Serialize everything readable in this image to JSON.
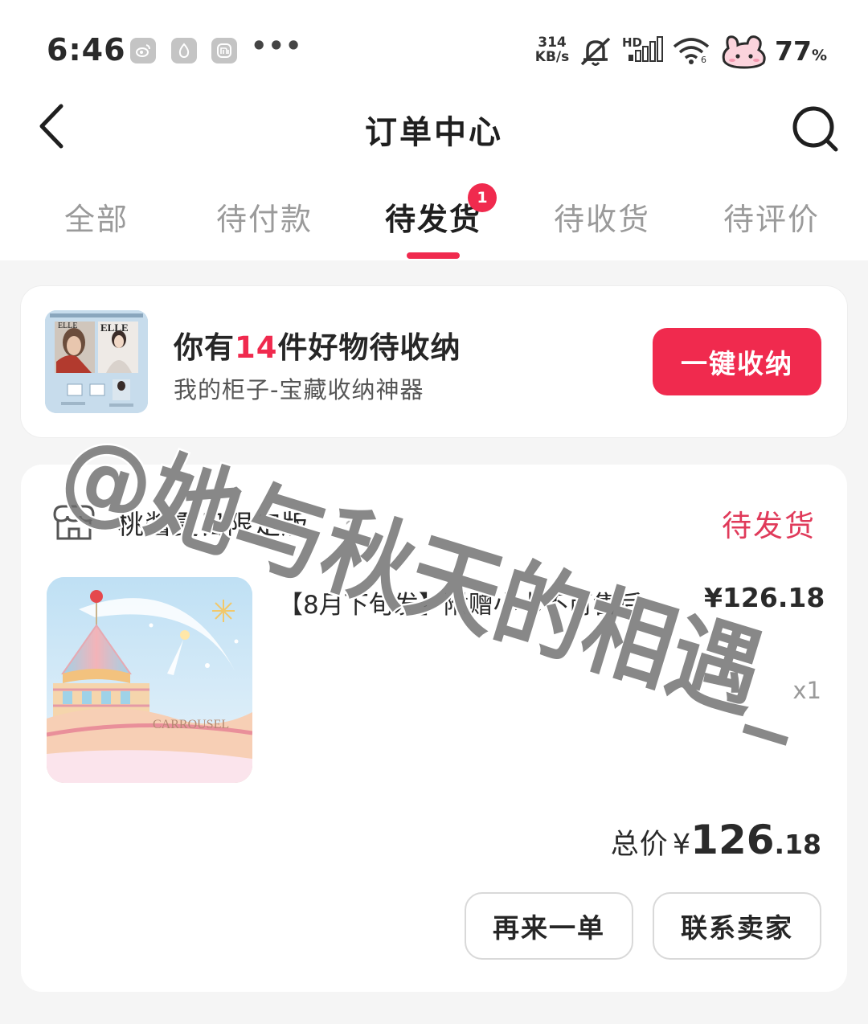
{
  "status_bar": {
    "time": "6:46",
    "net_speed_value": "314",
    "net_speed_unit": "KB/s",
    "hd_label": "HD",
    "wifi_sub": "6",
    "battery_pct": "77",
    "battery_unit": "%",
    "app_icons": [
      "weibo-icon",
      "app-drop-icon",
      "mi-icon"
    ],
    "more": "•••"
  },
  "header": {
    "title": "订单中心"
  },
  "tabs": [
    {
      "label": "全部"
    },
    {
      "label": "待付款"
    },
    {
      "label": "待发货",
      "badge": "1",
      "active": true
    },
    {
      "label": "待收货"
    },
    {
      "label": "待评价"
    }
  ],
  "promo": {
    "title_prefix": "你有",
    "title_count": "14",
    "title_suffix": "件好物待收纳",
    "subtitle": "我的柜子-宝藏收纳神器",
    "button_label": "一键收纳",
    "thumb_text": "ELLE"
  },
  "order": {
    "store_name": "桃酱夏日限定版",
    "store_chevron": "›",
    "status": "待发货",
    "product": {
      "title": "【8月下旬发】附赠小卡不可售后",
      "price": "¥126.18",
      "quantity": "x1",
      "image_text": "CARROUSEL"
    },
    "total": {
      "label": "总价",
      "currency": "¥",
      "integer": "126",
      "decimal": ".18"
    },
    "buttons": {
      "reorder": "再来一单",
      "contact": "联系卖家"
    }
  },
  "watermark": "@她与秋天的相遇_",
  "colors": {
    "accent": "#f02a4e",
    "status": "#e03a5a"
  }
}
